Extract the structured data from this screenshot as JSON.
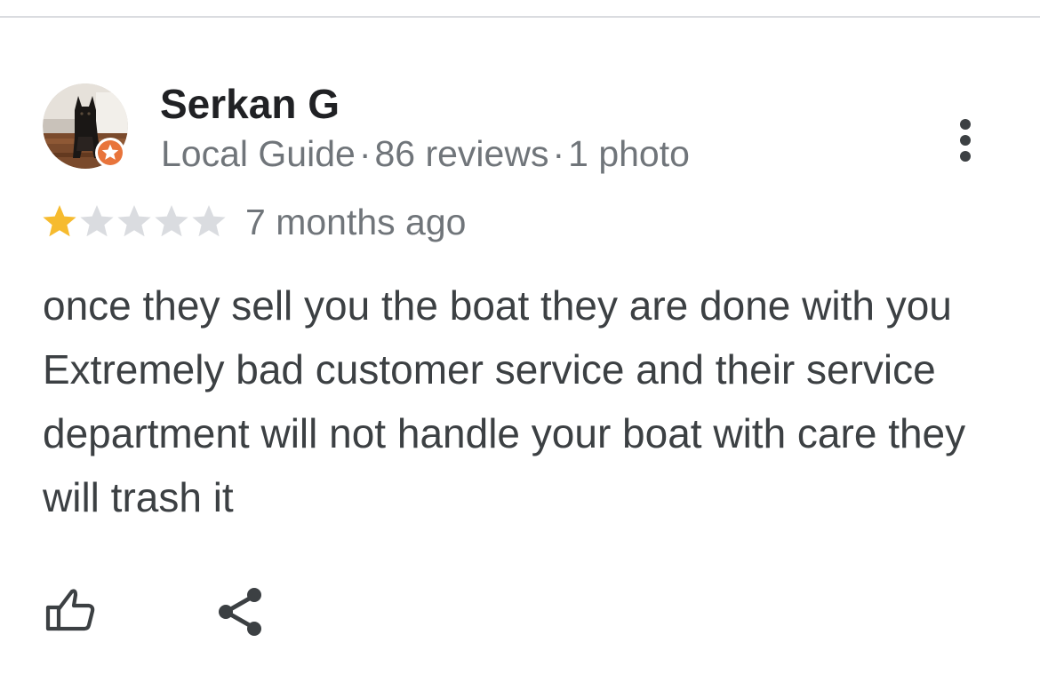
{
  "reviewer": {
    "name": "Serkan G",
    "badge": "Local Guide",
    "reviews_count": "86 reviews",
    "photos_count": "1 photo",
    "separator": "·"
  },
  "review": {
    "rating": 1,
    "max_rating": 5,
    "date": "7 months ago",
    "text": "once they sell you the boat they are done with you Extremely bad customer service and their service department will not handle your boat with care they will trash it"
  },
  "icons": {
    "more": "more-vert-icon",
    "like": "thumbs-up-icon",
    "share": "share-icon",
    "badge": "local-guide-star-icon",
    "star": "star-icon"
  },
  "colors": {
    "star_filled": "#f6bb2f",
    "star_empty": "#dadce0",
    "badge": "#e8743b",
    "name": "#202124",
    "secondary_text": "#70757a",
    "body_text": "#3c4043",
    "icon": "#3c4043",
    "divider": "#dadce0"
  }
}
